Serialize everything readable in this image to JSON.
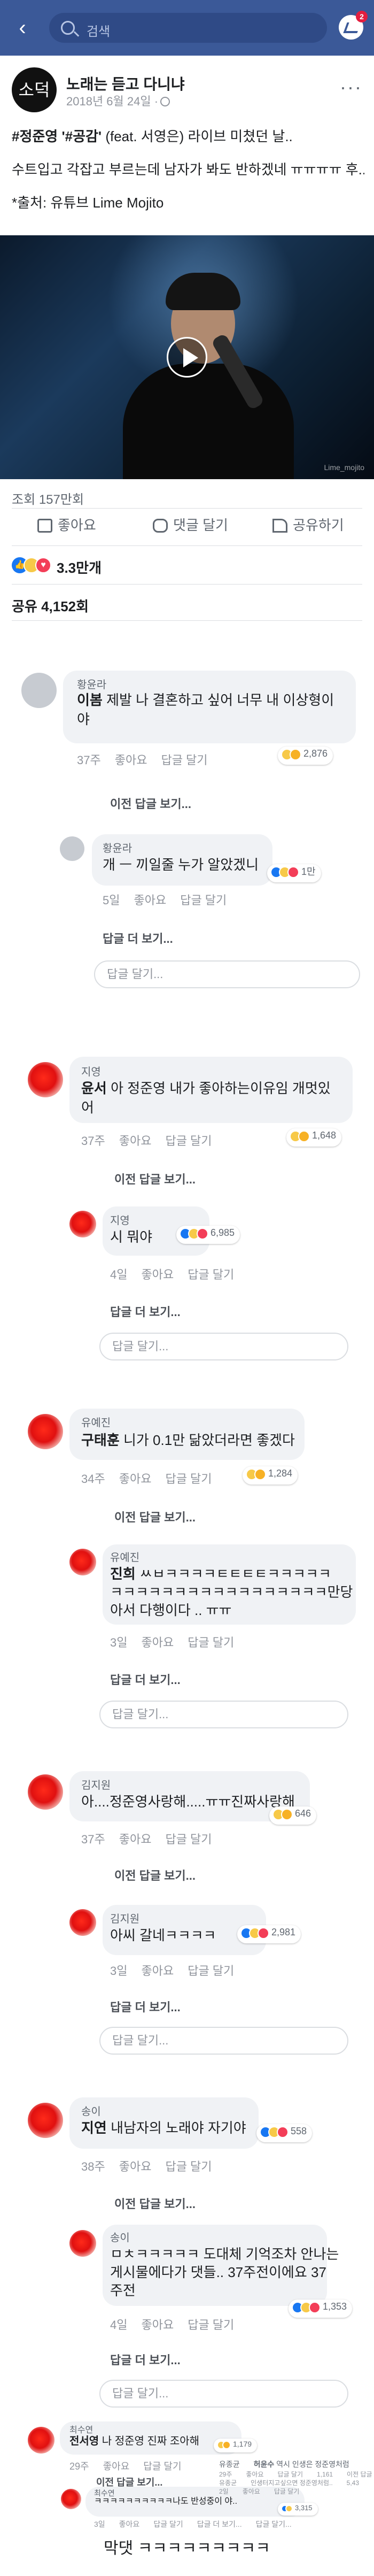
{
  "topbar": {
    "search_placeholder": "검색",
    "notification_count": "2"
  },
  "post": {
    "page_name": "노래는 듣고 다니냐",
    "date": "2018년 6월 24일 ·",
    "line1_tag": "#정준영 '#공감'",
    "line1_rest": " (feat. 서영은) 라이브 미쳤던 날..",
    "line2": "수트입고 각잡고 부르는데 남자가 봐도 반하겠네 ㅠㅠㅠㅠ 후..",
    "line3": "*출처: 유튜브 Lime Mojito",
    "video_watermark": "Lime_mojito",
    "views": "조회 157만회",
    "actions": {
      "like": "좋아요",
      "comment": "댓글 달기",
      "share": "공유하기"
    },
    "reaction_count": "3.3만개",
    "shares": "공유 4,152회"
  },
  "comments": {
    "c1": {
      "name": "황윤라",
      "mention": "이봄",
      "text1": " 제발 나 결혼하고 싶어 너무 내 이상형이",
      "text2": "야",
      "time": "37주",
      "like": "좋아요",
      "reply": "답글 달기",
      "reacts": "2,876",
      "prev": "이전 답글 보기...",
      "reply_name": "황윤라",
      "reply_text": "개 ㅡ 끼일줄 누가 알았겠니",
      "reply_reacts": "1만",
      "reply_time": "5일",
      "more": "답글 더 보기...",
      "input": "답글 달기..."
    },
    "c2": {
      "name": "지영",
      "mention": "윤서",
      "text1": " 아 정준영 내가 좋아하는이유임 개멋있",
      "text2": "어",
      "time": "37주",
      "like": "좋아요",
      "reply": "답글 달기",
      "reacts": "1,648",
      "prev": "이전 답글 보기...",
      "reply_name": "지영",
      "reply_text": "시      뭐야",
      "reply_reacts": "6,985",
      "reply_time": "4일",
      "more": "답글 더 보기...",
      "input": "답글 달기..."
    },
    "c3": {
      "name": "유예진",
      "mention": "구태훈",
      "text1": " 니가 0.1만 닮았더라면 좋겠다",
      "time": "34주",
      "like": "좋아요",
      "reply": "답글 달기",
      "reacts": "1,284",
      "prev": "이전 답글 보기...",
      "reply_name": "유예진",
      "reply_mention": "진희",
      "reply_text1": " ㅆㅂㅋㅋㅋㅋㅌㅌㅌㅌㅋㅋㅋㅋㅋ",
      "reply_text2": "ㅋㅋㅋㅋㅋㅋㅋㅋㅋㅋㅋㅋㅋㅋㅋㅋㅋ만당",
      "reply_text3": "아서 다행이다 .. ㅠㅠ",
      "reply_time": "3일",
      "more": "답글 더 보기...",
      "input": "답글 달기..."
    },
    "c4": {
      "name": "김지원",
      "mention": "",
      "text1": "아....정준영사랑해.....ㅠㅠ진짜사랑해",
      "time": "37주",
      "like": "좋아요",
      "reply": "답글 달기",
      "reacts": "646",
      "prev": "이전 답글 보기...",
      "reply_name": "김지원",
      "reply_text": "아씨       갈네ㅋㅋㅋㅋ",
      "reply_reacts": "2,981",
      "reply_time": "3일",
      "more": "답글 더 보기...",
      "input": "답글 달기..."
    },
    "c5": {
      "name": "송이",
      "mention": "지연",
      "text1": " 내남자의 노래야 자기야",
      "time": "38주",
      "like": "좋아요",
      "reply": "답글 달기",
      "reacts": "558",
      "prev": "이전 답글 보기...",
      "reply_name": "송이",
      "reply_text1": "ㅁㅊㅋㅋㅋㅋㅋ 도대체 기억조차 안나는",
      "reply_text2": "게시물에다가 댓들.. 37주전이에요 37",
      "reply_text3": "주전",
      "reply_reacts": "1,353",
      "reply_time": "4일",
      "more": "답글 더 보기...",
      "input": "답글 달기..."
    },
    "c6": {
      "name": "최수연",
      "mention": "전서영",
      "text1": " 나 정준영 진짜 조아해",
      "time": "29주",
      "like": "좋아요",
      "reply": "답글 달기",
      "reacts": "1,179",
      "prev": "이전 답글 보기...",
      "reply_name": "최수연",
      "reply_text1": "ㅋㅋㅋㅋㅋㅋㅋㅋㅋㅋ나도 반성중이",
      "reply_text2": "야..",
      "reply_reacts": "3,315",
      "reply_time": "3일",
      "more": "답글 더 보기...",
      "input": "답글 달기..."
    },
    "c7": {
      "name": "유종균",
      "mention": "허윤수",
      "text1": " 역시 인생은 정준영처럼",
      "time": "29주",
      "like": "좋아요",
      "reply": "답글 달기",
      "reacts": "1,161",
      "prev": "이전 답글 보기...",
      "reply_name": "유종균",
      "reply_text": "인생터지고싶으면 정준영처럼..",
      "reply_reacts": "5,43",
      "reply_time": "2일",
      "like2": "좋아요",
      "reply2": "답글 달기"
    }
  },
  "caption": "막댓 ㅋㅋㅋㅋㅋㅋㅋㅋㅋ"
}
